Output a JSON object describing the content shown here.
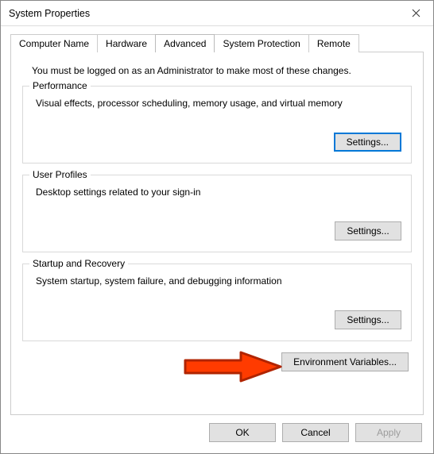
{
  "window": {
    "title": "System Properties"
  },
  "tabs": {
    "computer_name": "Computer Name",
    "hardware": "Hardware",
    "advanced": "Advanced",
    "system_protection": "System Protection",
    "remote": "Remote"
  },
  "advanced": {
    "admin_msg": "You must be logged on as an Administrator to make most of these changes.",
    "performance": {
      "title": "Performance",
      "desc": "Visual effects, processor scheduling, memory usage, and virtual memory",
      "settings_btn": "Settings..."
    },
    "user_profiles": {
      "title": "User Profiles",
      "desc": "Desktop settings related to your sign-in",
      "settings_btn": "Settings..."
    },
    "startup_recovery": {
      "title": "Startup and Recovery",
      "desc": "System startup, system failure, and debugging information",
      "settings_btn": "Settings..."
    },
    "env_vars_btn": "Environment Variables..."
  },
  "dialog_buttons": {
    "ok": "OK",
    "cancel": "Cancel",
    "apply": "Apply"
  },
  "annotation": {
    "arrow_color_fill": "#ff3b00",
    "arrow_color_stroke": "#b02400"
  }
}
